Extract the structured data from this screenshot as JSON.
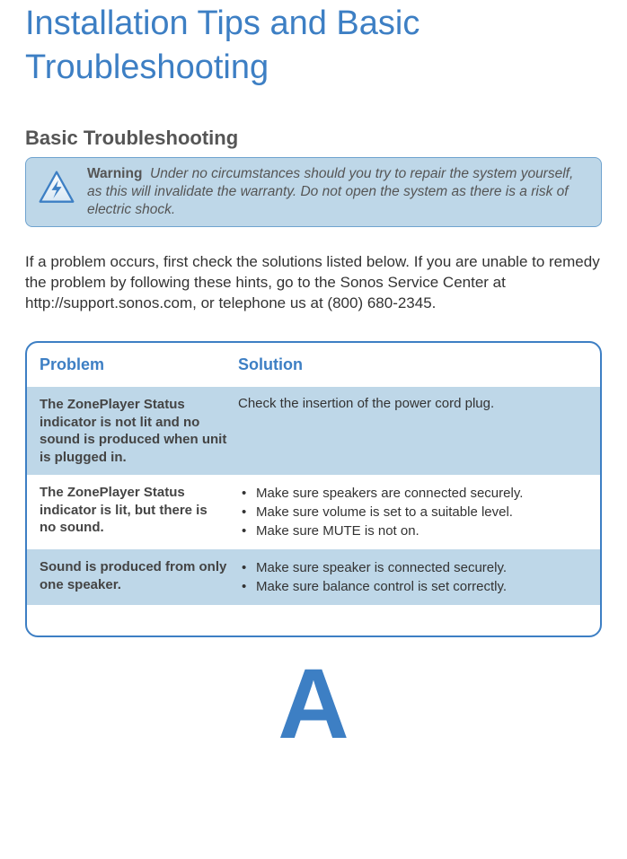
{
  "title": "Installation Tips and Basic Troubleshooting",
  "section_heading": "Basic Troubleshooting",
  "warning": {
    "label": "Warning",
    "text": "Under no circumstances should you try to repair the system yourself, as this will invalidate the warranty. Do not open the system as there is a risk of electric shock."
  },
  "intro_paragraph": "If a problem occurs, first check the solutions listed below. If you are unable to remedy the problem by following these hints, go to the Sonos Service Center at http://support.sonos.com, or telephone us at (800) 680-2345.",
  "table": {
    "header_problem": "Problem",
    "header_solution": "Solution",
    "rows": [
      {
        "problem": "The ZonePlayer Status indicator is not lit and no sound is produced when unit is plugged in.",
        "solution_single": "Check the insertion of the power cord plug."
      },
      {
        "problem": "The ZonePlayer Status indicator is lit, but there is no sound.",
        "solution_list": [
          "Make sure speakers are connected securely.",
          "Make sure volume is set to a suitable level.",
          "Make sure MUTE is not on."
        ]
      },
      {
        "problem": "Sound is produced from only one speaker.",
        "solution_list": [
          "Make sure speaker is connected securely.",
          "Make sure balance control is set correctly."
        ]
      }
    ]
  },
  "appendix_letter": "A"
}
